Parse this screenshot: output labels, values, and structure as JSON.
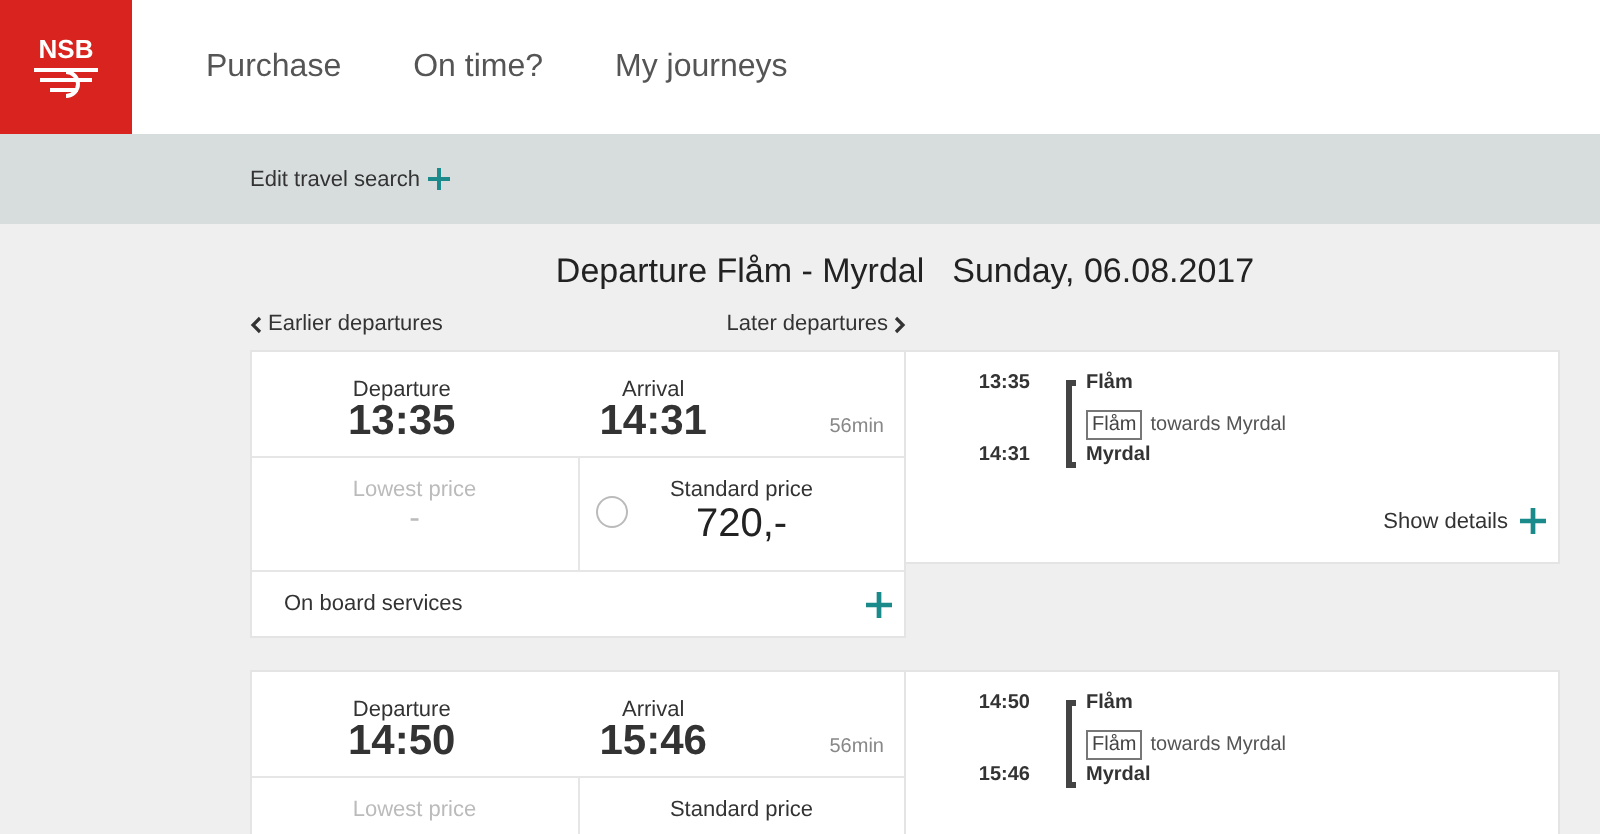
{
  "header": {
    "logo": "NSB",
    "nav": [
      {
        "label": "Purchase",
        "selected": false
      },
      {
        "label": "On time?",
        "selected": false
      },
      {
        "label": "My journeys",
        "selected": false
      }
    ]
  },
  "search_bar": {
    "label": "Edit travel search"
  },
  "title": {
    "route": "Departure Flåm - Myrdal",
    "date": "Sunday, 06.08.2017"
  },
  "paging": {
    "earlier": "Earlier departures",
    "later": "Later departures"
  },
  "journeys": [
    {
      "departure_label": "Departure",
      "departure": "13:35",
      "arrival_label": "Arrival",
      "arrival": "14:31",
      "duration": "56min",
      "lowest_label": "Lowest price",
      "lowest": "-",
      "standard_label": "Standard price",
      "standard": "720,-",
      "standard_selected": false,
      "services": "On board services",
      "route_departure": "13:35",
      "from": "Flåm",
      "route_arrival": "14:31",
      "to": "Myrdal",
      "line": "Flåm",
      "towards": "towards Myrdal",
      "details": "Show details"
    },
    {
      "departure_label": "Departure",
      "departure": "14:50",
      "arrival_label": "Arrival",
      "arrival": "15:46",
      "duration": "56min",
      "lowest_label": "Lowest price",
      "standard_label": "Standard price",
      "route_departure": "14:50",
      "from": "Flåm",
      "route_arrival": "15:46",
      "to": "Myrdal",
      "line": "Flåm",
      "towards": "towards Myrdal"
    }
  ]
}
